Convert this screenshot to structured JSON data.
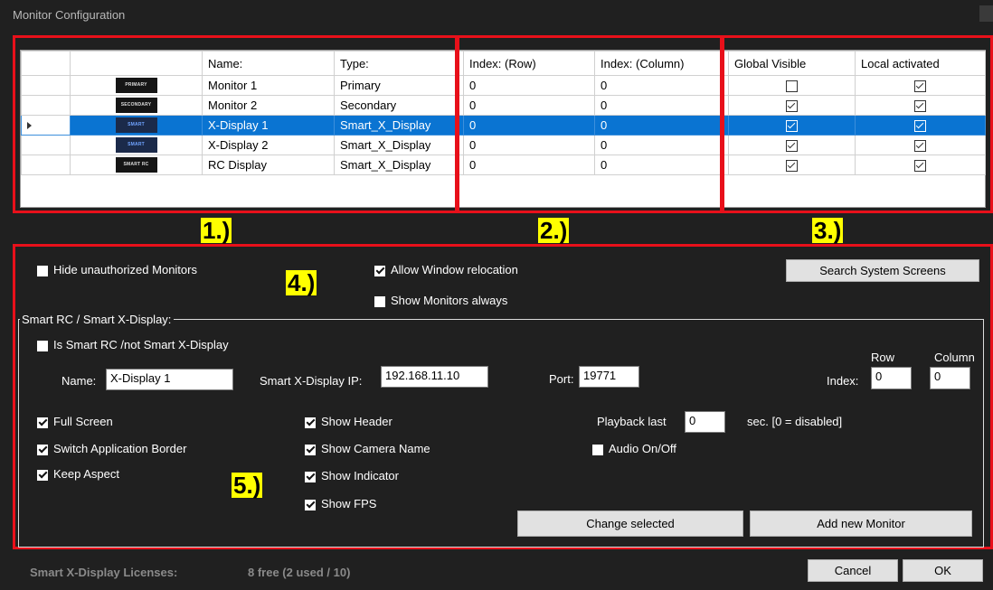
{
  "window": {
    "title": "Monitor Configuration"
  },
  "grid": {
    "headers": [
      "Name:",
      "Type:",
      "Index: (Row)",
      "Index: (Column)",
      "Global Visible",
      "Local activated"
    ],
    "rows": [
      {
        "thumb": "PRIMARY",
        "name": "Monitor 1",
        "type": "Primary",
        "row": "0",
        "col": "0",
        "global": false,
        "local": true,
        "selected": false
      },
      {
        "thumb": "SECONDARY",
        "name": "Monitor 2",
        "type": "Secondary",
        "row": "0",
        "col": "0",
        "global": true,
        "local": true,
        "selected": false
      },
      {
        "thumb": "SMART",
        "name": "X-Display 1",
        "type": "Smart_X_Display",
        "row": "0",
        "col": "0",
        "global": true,
        "local": true,
        "selected": true
      },
      {
        "thumb": "SMART",
        "name": "X-Display 2",
        "type": "Smart_X_Display",
        "row": "0",
        "col": "0",
        "global": true,
        "local": true,
        "selected": false
      },
      {
        "thumb": "SMART RC",
        "name": "RC Display",
        "type": "Smart_X_Display",
        "row": "0",
        "col": "0",
        "global": true,
        "local": true,
        "selected": false
      }
    ]
  },
  "markers": {
    "m1": "1.)",
    "m2": "2.)",
    "m3": "3.)",
    "m4": "4.)",
    "m5": "5.)"
  },
  "options": {
    "hide_unauthorized": "Hide unauthorized Monitors",
    "allow_relocation": "Allow Window relocation",
    "show_monitors_always": "Show Monitors always",
    "search_button": "Search System Screens"
  },
  "smart": {
    "legend": "Smart RC  /  Smart X-Display:",
    "is_smart_rc": "Is Smart RC /not Smart X-Display",
    "name_label": "Name:",
    "name_value": "X-Display 1",
    "ip_label": "Smart X-Display IP:",
    "ip_value": "192.168.11.10",
    "port_label": "Port:",
    "port_value": "19771",
    "row_label": "Row",
    "column_label": "Column",
    "index_label": "Index:",
    "index_row": "0",
    "index_col": "0",
    "full_screen": "Full Screen",
    "switch_border": "Switch Application Border",
    "keep_aspect": "Keep Aspect",
    "show_header": "Show Header",
    "show_camera_name": "Show Camera Name",
    "show_indicator": "Show Indicator",
    "show_fps": "Show FPS",
    "playback_label": "Playback last",
    "playback_value": "0",
    "playback_suffix": "sec. [0 = disabled]",
    "audio": "Audio On/Off",
    "change_selected": "Change selected",
    "add_new_monitor": "Add new Monitor"
  },
  "footer": {
    "licenses_label": "Smart X-Display Licenses:",
    "licenses_value": "8 free (2 used / 10)",
    "cancel": "Cancel",
    "ok": "OK"
  }
}
